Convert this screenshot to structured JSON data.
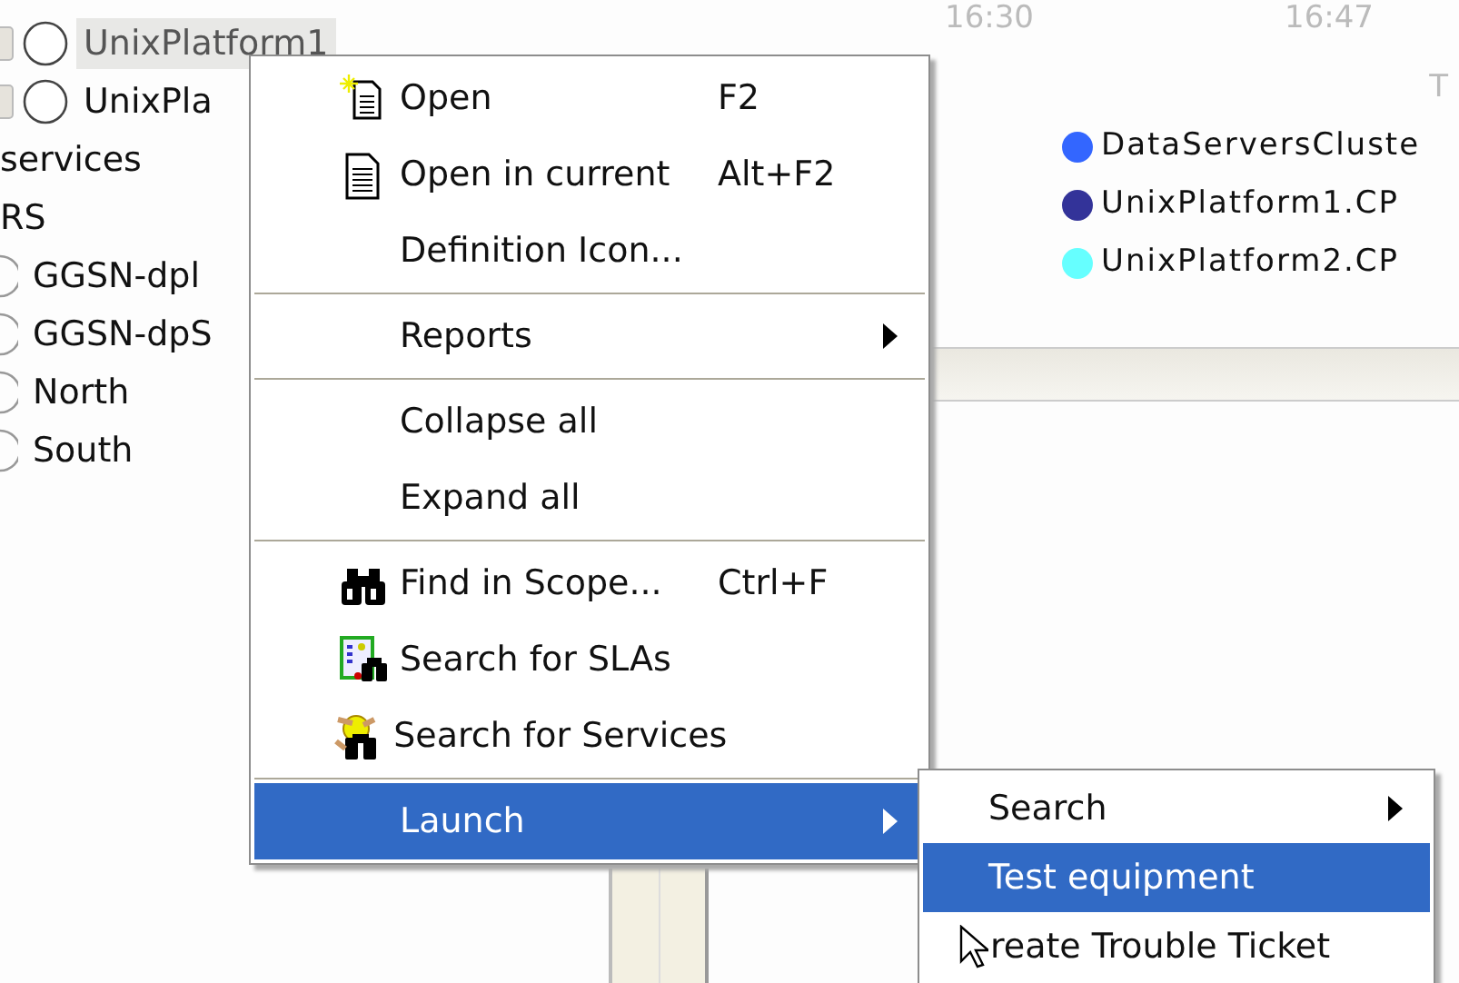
{
  "tree": [
    {
      "label": "UnixPlatform1",
      "kind": "platform",
      "selected": true
    },
    {
      "label": "UnixPla",
      "kind": "platform",
      "selected": false
    },
    {
      "label": "services",
      "kind": "group",
      "selected": false
    },
    {
      "label": "RS",
      "kind": "group",
      "selected": false
    },
    {
      "label": "GGSN-dpl",
      "kind": "leaf",
      "selected": false
    },
    {
      "label": "GGSN-dpS",
      "kind": "leaf",
      "selected": false
    },
    {
      "label": "North",
      "kind": "leaf",
      "selected": false
    },
    {
      "label": "South",
      "kind": "leaf",
      "selected": false
    }
  ],
  "chart": {
    "time_labels": [
      "16:30",
      "16:47"
    ],
    "corner_label": "T",
    "legend": [
      {
        "label": "DataServersCluste",
        "color": "#3366ff"
      },
      {
        "label": "UnixPlatform1.CP",
        "color": "#333399"
      },
      {
        "label": "UnixPlatform2.CP",
        "color": "#66ffff"
      }
    ]
  },
  "context_menu": [
    {
      "kind": "item",
      "label": "Open",
      "shortcut": "F2",
      "submenu": false,
      "selected": false
    },
    {
      "kind": "item",
      "label": "Open in current",
      "shortcut": "Alt+F2",
      "submenu": false,
      "selected": false
    },
    {
      "kind": "item",
      "label": "Definition Icon...",
      "submenu": false,
      "selected": false
    },
    {
      "kind": "separator"
    },
    {
      "kind": "item",
      "label": "Reports",
      "submenu": true,
      "selected": false
    },
    {
      "kind": "separator"
    },
    {
      "kind": "item",
      "label": "Collapse all",
      "submenu": false,
      "selected": false
    },
    {
      "kind": "item",
      "label": "Expand all",
      "submenu": false,
      "selected": false
    },
    {
      "kind": "separator"
    },
    {
      "kind": "item",
      "label": "Find in Scope...",
      "shortcut": "Ctrl+F",
      "submenu": false,
      "selected": false
    },
    {
      "kind": "item",
      "label": "Search for SLAs",
      "submenu": false,
      "selected": false
    },
    {
      "kind": "item",
      "label": "Search for Services",
      "submenu": false,
      "selected": false
    },
    {
      "kind": "separator"
    },
    {
      "kind": "item",
      "label": "Launch",
      "submenu": true,
      "selected": true
    }
  ],
  "submenu": [
    {
      "label": "Search",
      "submenu": true,
      "selected": false
    },
    {
      "label": "Test equipment",
      "submenu": false,
      "selected": true
    },
    {
      "label": "reate Trouble Ticket",
      "submenu": false,
      "selected": false,
      "pointer": true
    }
  ]
}
